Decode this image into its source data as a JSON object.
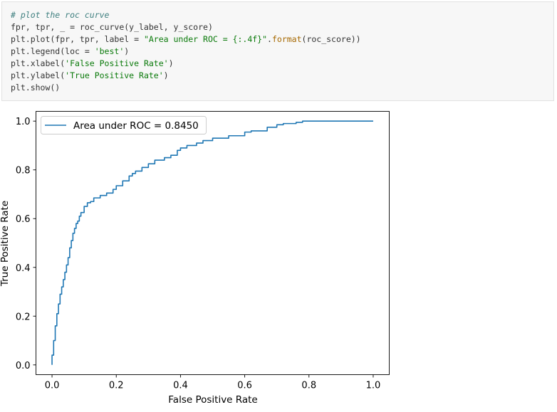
{
  "code_cell": {
    "lines": [
      [
        {
          "t": "# plot the roc curve",
          "c": "cm"
        }
      ],
      [
        {
          "t": "fpr, tpr, _ = roc_curve(y_label, y_score)",
          "c": ""
        }
      ],
      [
        {
          "t": "plt.plot(fpr, tpr, label = ",
          "c": ""
        },
        {
          "t": "\"Area under ROC = {:.4f}\"",
          "c": "st"
        },
        {
          "t": ".",
          "c": ""
        },
        {
          "t": "format",
          "c": "fm"
        },
        {
          "t": "(roc_score))",
          "c": ""
        }
      ],
      [
        {
          "t": "plt.legend(loc = ",
          "c": ""
        },
        {
          "t": "'best'",
          "c": "st"
        },
        {
          "t": ")",
          "c": ""
        }
      ],
      [
        {
          "t": "plt.xlabel(",
          "c": ""
        },
        {
          "t": "'False Positive Rate'",
          "c": "st"
        },
        {
          "t": ")",
          "c": ""
        }
      ],
      [
        {
          "t": "plt.ylabel(",
          "c": ""
        },
        {
          "t": "'True Positive Rate'",
          "c": "st"
        },
        {
          "t": ")",
          "c": ""
        }
      ],
      [
        {
          "t": "plt.show()",
          "c": ""
        }
      ]
    ]
  },
  "chart_data": {
    "type": "line",
    "title": "",
    "xlabel": "False Positive Rate",
    "ylabel": "True Positive Rate",
    "xlim": [
      -0.05,
      1.05
    ],
    "ylim": [
      -0.04,
      1.04
    ],
    "xticks": [
      "0.0",
      "0.2",
      "0.4",
      "0.6",
      "0.8",
      "1.0"
    ],
    "yticks": [
      "0.0",
      "0.2",
      "0.4",
      "0.6",
      "0.8",
      "1.0"
    ],
    "legend_placement": "top-left",
    "grid": false,
    "series": [
      {
        "name": "Area under ROC = 0.8450",
        "color": "#1f77b4",
        "x": [
          0.0,
          0.0,
          0.005,
          0.005,
          0.01,
          0.01,
          0.015,
          0.015,
          0.02,
          0.02,
          0.025,
          0.025,
          0.03,
          0.03,
          0.035,
          0.035,
          0.04,
          0.04,
          0.045,
          0.045,
          0.05,
          0.05,
          0.055,
          0.055,
          0.06,
          0.06,
          0.065,
          0.065,
          0.07,
          0.07,
          0.075,
          0.075,
          0.08,
          0.08,
          0.085,
          0.085,
          0.09,
          0.09,
          0.1,
          0.1,
          0.11,
          0.11,
          0.12,
          0.12,
          0.13,
          0.13,
          0.15,
          0.15,
          0.17,
          0.17,
          0.19,
          0.19,
          0.2,
          0.2,
          0.22,
          0.22,
          0.24,
          0.24,
          0.25,
          0.25,
          0.26,
          0.26,
          0.28,
          0.28,
          0.3,
          0.3,
          0.32,
          0.32,
          0.35,
          0.35,
          0.37,
          0.37,
          0.39,
          0.39,
          0.4,
          0.4,
          0.42,
          0.42,
          0.45,
          0.45,
          0.47,
          0.47,
          0.5,
          0.5,
          0.55,
          0.55,
          0.6,
          0.6,
          0.62,
          0.62,
          0.67,
          0.67,
          0.7,
          0.7,
          0.72,
          0.72,
          0.76,
          0.76,
          0.78,
          0.78,
          0.95,
          0.95,
          1.0
        ],
        "y": [
          0.0,
          0.04,
          0.04,
          0.1,
          0.1,
          0.16,
          0.16,
          0.21,
          0.21,
          0.25,
          0.25,
          0.29,
          0.29,
          0.32,
          0.32,
          0.35,
          0.35,
          0.38,
          0.38,
          0.41,
          0.41,
          0.44,
          0.44,
          0.48,
          0.48,
          0.51,
          0.51,
          0.54,
          0.54,
          0.56,
          0.56,
          0.58,
          0.58,
          0.59,
          0.59,
          0.61,
          0.61,
          0.625,
          0.625,
          0.65,
          0.65,
          0.665,
          0.665,
          0.67,
          0.67,
          0.685,
          0.685,
          0.695,
          0.695,
          0.705,
          0.705,
          0.72,
          0.72,
          0.735,
          0.735,
          0.755,
          0.755,
          0.775,
          0.775,
          0.785,
          0.785,
          0.795,
          0.795,
          0.81,
          0.81,
          0.825,
          0.825,
          0.84,
          0.84,
          0.85,
          0.85,
          0.86,
          0.86,
          0.88,
          0.88,
          0.89,
          0.89,
          0.9,
          0.9,
          0.91,
          0.91,
          0.92,
          0.92,
          0.93,
          0.93,
          0.94,
          0.94,
          0.955,
          0.955,
          0.96,
          0.96,
          0.975,
          0.975,
          0.985,
          0.985,
          0.99,
          0.99,
          0.995,
          0.995,
          1.0,
          1.0,
          1.0,
          1.0
        ]
      }
    ]
  }
}
